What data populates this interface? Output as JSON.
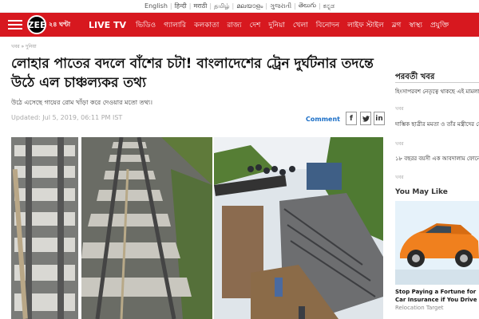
{
  "lang_bar": [
    "English",
    "हिन्दी",
    "मराठी",
    "தமிழ்",
    "മലയാളം",
    "ગુજરાતી",
    "తెలుగు",
    "ಕನ್ನಡ"
  ],
  "nav": {
    "logo_text": "ZEE",
    "logo_suffix": "২৪ ঘণ্টা",
    "live_label": "LIVE TV",
    "items": [
      "ভিডিও",
      "গ্যালারি",
      "কলকাতা",
      "রাজ্য",
      "দেশ",
      "দুনিয়া",
      "খেলা",
      "বিনোদন",
      "লাইফ স্টাইল",
      "ব্লগ",
      "স্বাস্থ্য",
      "প্রযুক্তি"
    ]
  },
  "breadcrumb": "খবর » দুনিয়া",
  "article": {
    "headline": "লোহার পাতের বদলে বাঁশের চটা! বাংলাদেশের ট্রেন দুর্ঘটনার তদন্তে উঠে এল চাঞ্চল্যকর তথ্য",
    "subheadline": "উঠে এসেছে গায়ের রোম খাঁড়া করে দেওয়ার মতো তথ্য।",
    "updated": "Updated: Jul 5, 2019, 06:11 PM IST",
    "comment_label": "Comment",
    "share_icons": [
      "facebook-icon",
      "twitter-icon",
      "linkedin-icon"
    ]
  },
  "sidebar": {
    "title": "পরবর্তী খবর",
    "items": [
      "হিংসাপরবশ নেতৃত্বে থাকছে এই মামলাতেই বিদেশের ফিরলেন সুনাম",
      "খবর",
      "দাম্ভিক ছাত্রীর মমতা ও তাঁর মন্ত্রীদের ফোন, স্বাগত জানালেন",
      "খবর",
      "১৮ বছরর বয়সী এক আবদালাম ফোনে নতুন কিছু হওয়ার আশায় কেন মুখ খুলছে না",
      "খবর"
    ],
    "you_may_like": "You May Like",
    "ad_title": "Stop Paying a Fortune for Car Insurance if You Drive Less Cars in Bangladesh",
    "ad_source": "Relocation Target"
  },
  "colors": {
    "brand_red": "#d7181f",
    "link_blue": "#1a6ec7"
  }
}
